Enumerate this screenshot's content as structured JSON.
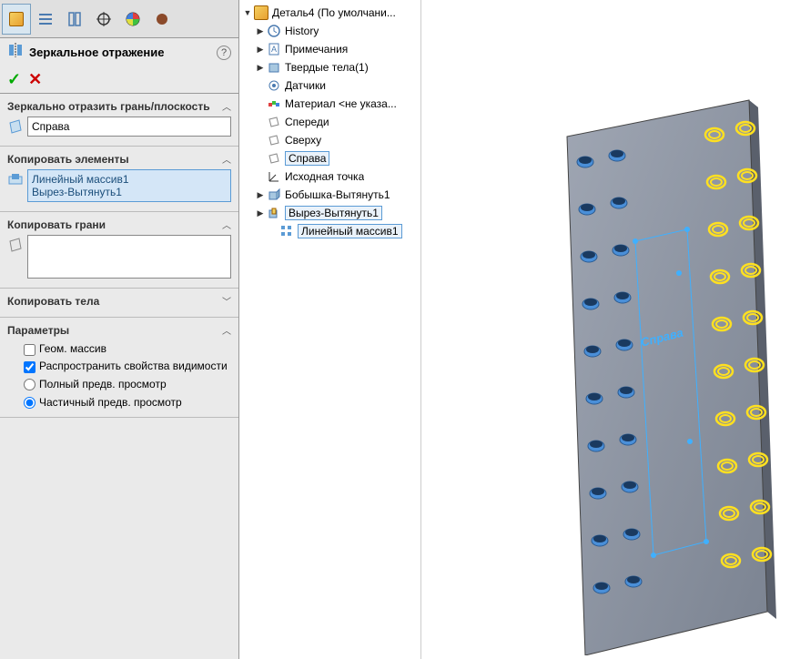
{
  "top_tabs": {
    "features_active": true
  },
  "feature": {
    "title": "Зеркальное отражение",
    "help": "?"
  },
  "sections": {
    "mirror_plane": {
      "title": "Зеркально отразить грань/плоскость",
      "value": "Справа"
    },
    "copy_features": {
      "title": "Копировать элементы",
      "items": [
        "Линейный массив1",
        "Вырез-Вытянуть1"
      ]
    },
    "copy_faces": {
      "title": "Копировать грани"
    },
    "copy_bodies": {
      "title": "Копировать тела"
    },
    "options": {
      "title": "Параметры",
      "geom_pattern": "Геом. массив",
      "propagate_vis": "Распространить свойства видимости",
      "propagate_vis_checked": true,
      "full_preview": "Полный предв. просмотр",
      "partial_preview": "Частичный предв. просмотр",
      "partial_selected": true
    }
  },
  "tree": {
    "root": "Деталь4  (По умолчани...",
    "history": "History",
    "notes": "Примечания",
    "bodies": "Твердые тела(1)",
    "sensors": "Датчики",
    "material": "Материал <не указа...",
    "front": "Спереди",
    "top": "Сверху",
    "right": "Справа",
    "origin": "Исходная точка",
    "boss": "Бобышка-Вытянуть1",
    "cut": "Вырез-Вытянуть1",
    "linear": "Линейный массив1"
  },
  "viewport": {
    "plane_label": "Справа"
  }
}
